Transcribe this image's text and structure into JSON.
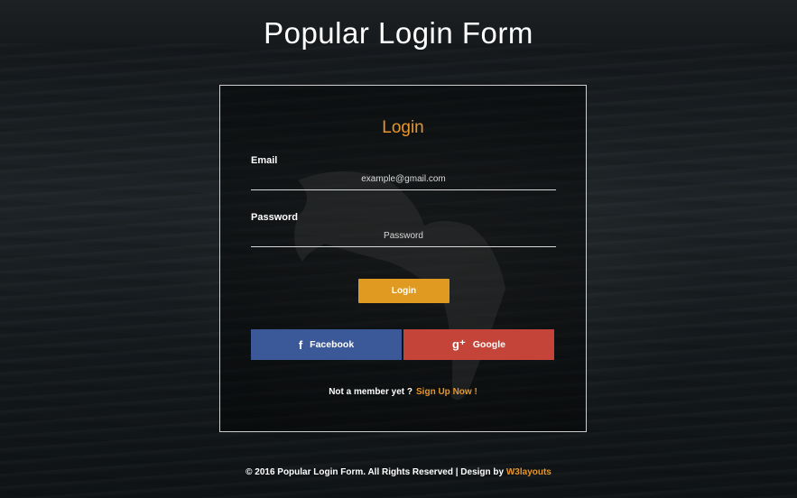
{
  "page": {
    "title": "Popular Login Form"
  },
  "login_card": {
    "heading": "Login",
    "email": {
      "label": "Email",
      "placeholder": "example@gmail.com"
    },
    "password": {
      "label": "Password",
      "placeholder": "Password"
    },
    "submit_label": "Login",
    "social": {
      "facebook": {
        "label": "Facebook",
        "icon": "facebook-icon",
        "icon_glyph": "f",
        "color": "#3b5998"
      },
      "google": {
        "label": "Google",
        "icon": "google-plus-icon",
        "icon_glyph": "g⁺",
        "color": "#c4443a"
      }
    },
    "member_text": "Not a member yet ?",
    "signup_link": "Sign Up Now !"
  },
  "footer": {
    "text": "© 2016 Popular Login Form. All Rights Reserved | Design by",
    "credit_link": "W3layouts"
  },
  "colors": {
    "accent": "#e8962a",
    "button": "#e09a21"
  }
}
